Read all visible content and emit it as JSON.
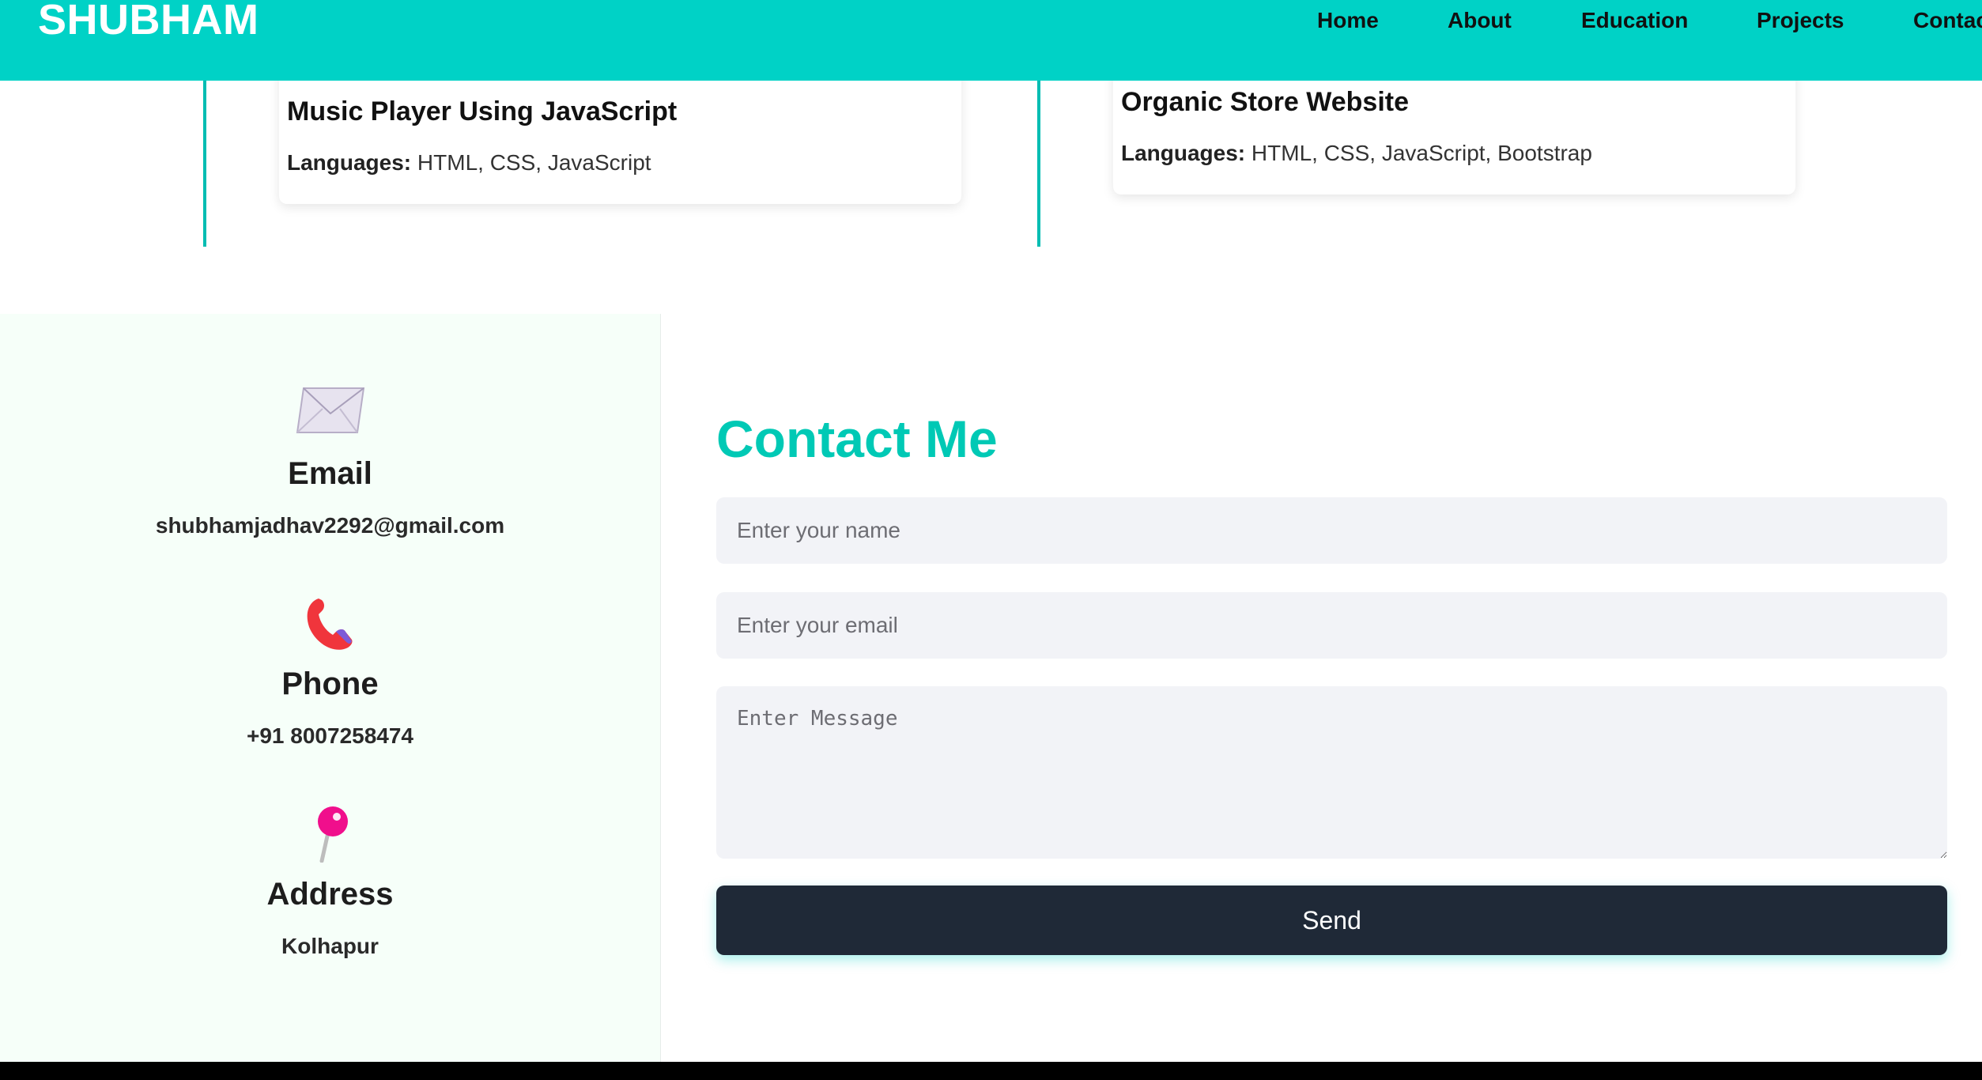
{
  "navbar": {
    "brand": "SHUBHAM",
    "links": [
      "Home",
      "About",
      "Education",
      "Projects",
      "Contact"
    ]
  },
  "projects": [
    {
      "title": "Music Player Using JavaScript",
      "languages_label": "Languages:",
      "languages": "HTML, CSS, JavaScript"
    },
    {
      "title": "Organic Store Website",
      "languages_label": "Languages:",
      "languages": "HTML, CSS, JavaScript, Bootstrap"
    }
  ],
  "contact_info": {
    "email": {
      "label": "Email",
      "value": "shubhamjadhav2292@gmail.com",
      "icon": "envelope-icon"
    },
    "phone": {
      "label": "Phone",
      "value": "+91 8007258474",
      "icon": "phone-icon"
    },
    "address": {
      "label": "Address",
      "value": "Kolhapur",
      "icon": "pushpin-icon"
    }
  },
  "contact_form": {
    "title": "Contact Me",
    "name_placeholder": "Enter your name",
    "email_placeholder": "Enter your email",
    "message_placeholder": "Enter Message",
    "send_label": "Send"
  },
  "colors": {
    "accent": "#00d2c6",
    "heading": "#00c9b5",
    "button": "#1f2937"
  }
}
